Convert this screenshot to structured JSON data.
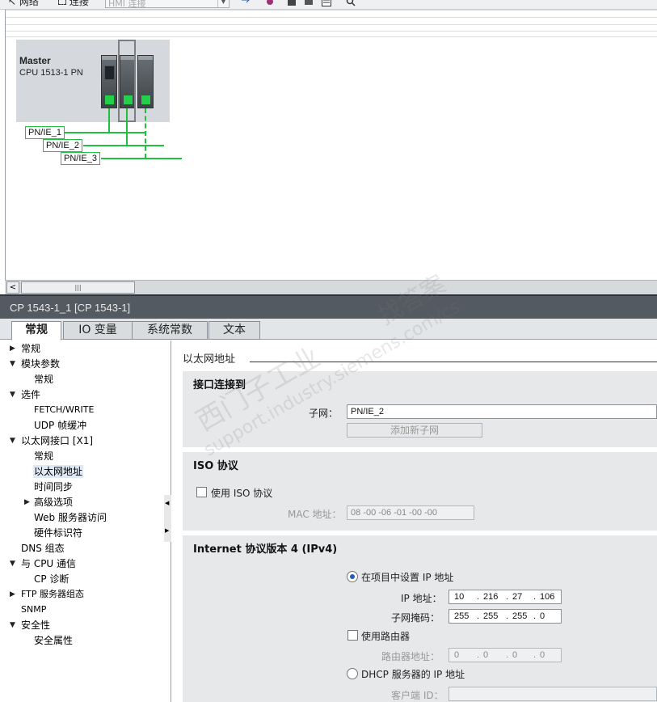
{
  "toolbar": {
    "network_label": "网络",
    "connections_label": "连接",
    "connection_type": "HMI 连接"
  },
  "network": {
    "station_name": "Master",
    "cpu_type": "CPU 1513-1 PN",
    "subnets": [
      "PN/IE_1",
      "PN/IE_2",
      "PN/IE_3"
    ],
    "port_color": "#22d04a",
    "line_color": "#22c040"
  },
  "inspector": {
    "title": "CP 1543-1_1 [CP 1543-1]",
    "tabs": [
      "常规",
      "IO 变量",
      "系统常数",
      "文本"
    ],
    "active_tab": "常规"
  },
  "tree": {
    "items": [
      {
        "label": "常规",
        "arrow": "▶"
      },
      {
        "label": "模块参数",
        "arrow": "▼"
      },
      {
        "label": "常规",
        "arrow": ""
      },
      {
        "label": "选件",
        "arrow": "▼"
      },
      {
        "label": "FETCH/WRITE",
        "arrow": ""
      },
      {
        "label": "UDP 帧缓冲",
        "arrow": ""
      },
      {
        "label": "以太网接口 [X1]",
        "arrow": "▼"
      },
      {
        "label": "常规",
        "arrow": ""
      },
      {
        "label": "以太网地址",
        "arrow": ""
      },
      {
        "label": "时间同步",
        "arrow": ""
      },
      {
        "label": "高级选项",
        "arrow": "▶"
      },
      {
        "label": "Web 服务器访问",
        "arrow": ""
      },
      {
        "label": "硬件标识符",
        "arrow": ""
      },
      {
        "label": "DNS 组态",
        "arrow": ""
      },
      {
        "label": "与 CPU 通信",
        "arrow": "▼"
      },
      {
        "label": "CP 诊断",
        "arrow": ""
      },
      {
        "label": "FTP 服务器组态",
        "arrow": "▶"
      },
      {
        "label": "SNMP",
        "arrow": ""
      },
      {
        "label": "安全性",
        "arrow": "▼"
      },
      {
        "label": "安全属性",
        "arrow": ""
      }
    ],
    "selected": "以太网地址"
  },
  "content": {
    "section_title": "以太网地址",
    "interface": {
      "heading": "接口连接到",
      "subnet_label": "子网：",
      "subnet_value": "PN/IE_2",
      "add_subnet_button": "添加新子网"
    },
    "iso": {
      "heading": "ISO 协议",
      "use_iso_label": "使用 ISO 协议",
      "use_iso_checked": false,
      "mac_label": "MAC 地址：",
      "mac_value": "08 -00 -06 -01 -00 -00"
    },
    "ipv4": {
      "heading": "Internet 协议版本 4 (IPv4)",
      "set_in_project_label": "在项目中设置 IP 地址",
      "set_in_project_selected": true,
      "ip_label": "IP 地址：",
      "ip": [
        "10",
        "216",
        "27",
        "106"
      ],
      "mask_label": "子网掩码：",
      "mask": [
        "255",
        "255",
        "255",
        "0"
      ],
      "use_router_label": "使用路由器",
      "use_router_checked": false,
      "router_label": "路由器地址：",
      "router": [
        "0",
        "0",
        "0",
        "0"
      ],
      "dhcp_label": "DHCP 服务器的 IP 地址",
      "client_id_label": "客户端 ID："
    }
  },
  "watermark": {
    "line1": "找答案",
    "line2": "西门子工业",
    "line3": "support.industry.siemens.com/cs"
  }
}
